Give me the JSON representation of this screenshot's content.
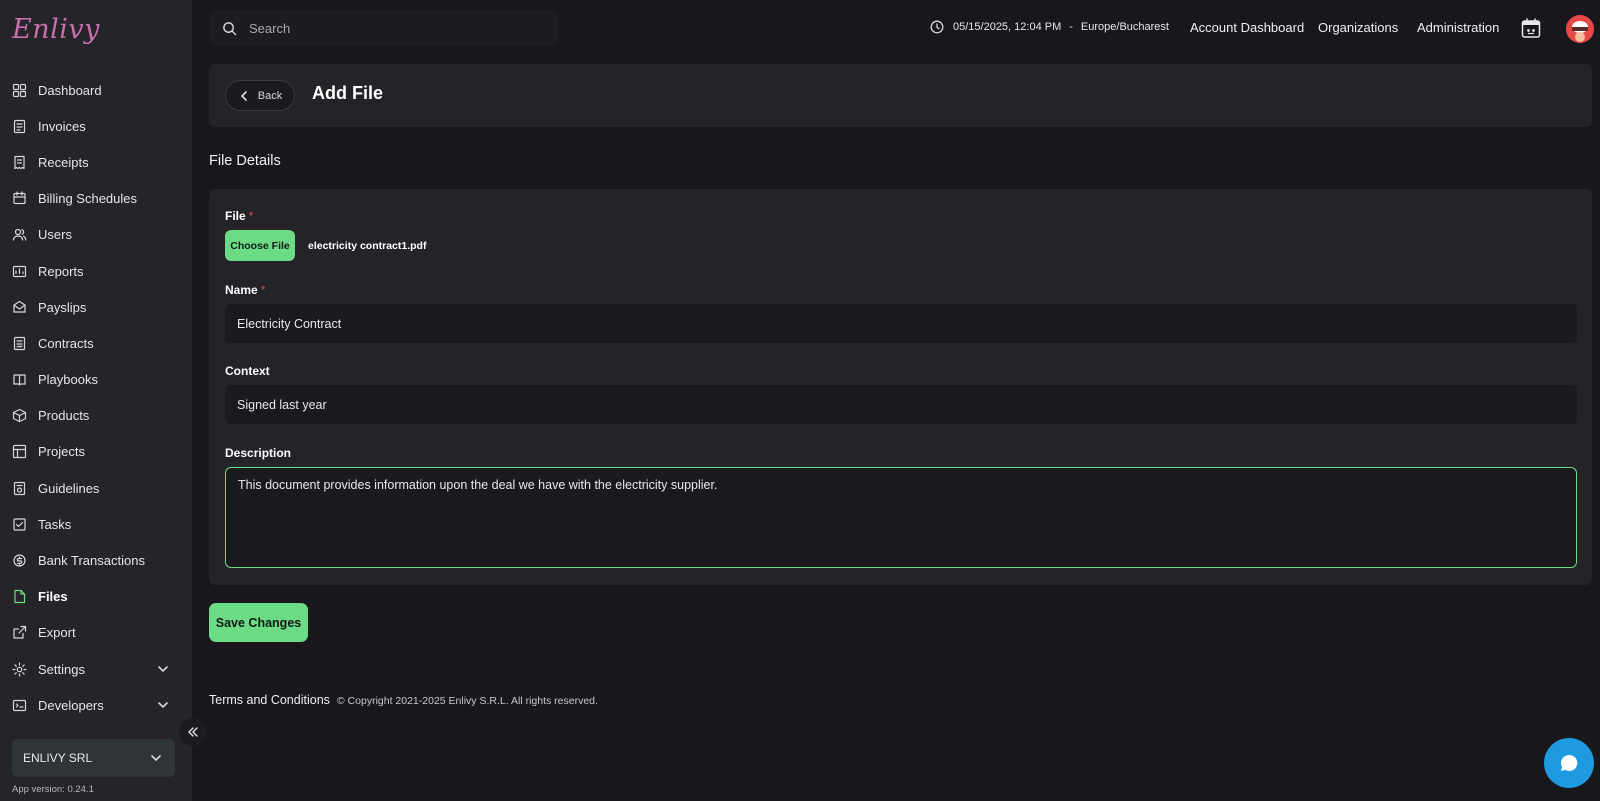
{
  "brand": {
    "logo_text": "Enlivy"
  },
  "header": {
    "search_placeholder": "Search",
    "date_time": "05/15/2025, 12:04 PM",
    "date_sep": "-",
    "timezone": "Europe/Bucharest",
    "links": [
      "Account Dashboard",
      "Organizations",
      "Administration"
    ]
  },
  "sidebar": {
    "items": [
      {
        "label": "Dashboard",
        "icon": "dashboard-icon"
      },
      {
        "label": "Invoices",
        "icon": "invoice-icon"
      },
      {
        "label": "Receipts",
        "icon": "receipt-icon"
      },
      {
        "label": "Billing Schedules",
        "icon": "billing-schedule-icon"
      },
      {
        "label": "Users",
        "icon": "users-icon"
      },
      {
        "label": "Reports",
        "icon": "reports-icon"
      },
      {
        "label": "Payslips",
        "icon": "payslip-icon"
      },
      {
        "label": "Contracts",
        "icon": "contract-icon"
      },
      {
        "label": "Playbooks",
        "icon": "playbook-icon"
      },
      {
        "label": "Products",
        "icon": "product-box-icon"
      },
      {
        "label": "Projects",
        "icon": "project-icon"
      },
      {
        "label": "Guidelines",
        "icon": "guidelines-icon"
      },
      {
        "label": "Tasks",
        "icon": "tasks-icon"
      },
      {
        "label": "Bank Transactions",
        "icon": "bank-transaction-icon"
      },
      {
        "label": "Files",
        "icon": "file-icon",
        "active": true
      },
      {
        "label": "Export",
        "icon": "export-icon"
      },
      {
        "label": "Settings",
        "icon": "settings-icon",
        "expandable": true
      },
      {
        "label": "Developers",
        "icon": "developer-icon",
        "expandable": true
      }
    ],
    "organization": "ENLIVY SRL",
    "app_version": "App version: 0.24.1"
  },
  "page": {
    "back_label": "Back",
    "title": "Add File",
    "section_title": "File Details"
  },
  "form": {
    "file_label": "File",
    "required_mark": "*",
    "choose_file_label": "Choose File",
    "selected_file": "electricity contract1.pdf",
    "name_label": "Name",
    "name_value": "Electricity Contract",
    "context_label": "Context",
    "context_value": "Signed last year",
    "description_label": "Description",
    "description_value": "This document provides information upon the deal we have with the electricity supplier."
  },
  "actions": {
    "save_label": "Save Changes"
  },
  "footer": {
    "terms": "Terms and Conditions",
    "copyright": "© Copyright 2021-2025 Enlivy S.R.L. All rights reserved."
  },
  "colors": {
    "accent_green": "#6cdb86",
    "background": "#17171c",
    "sidebar_bg": "#242429",
    "card_bg": "#232328",
    "chat_blue": "#1e9be0",
    "required_red": "#e04848",
    "logo_pink": "#c86fae"
  }
}
